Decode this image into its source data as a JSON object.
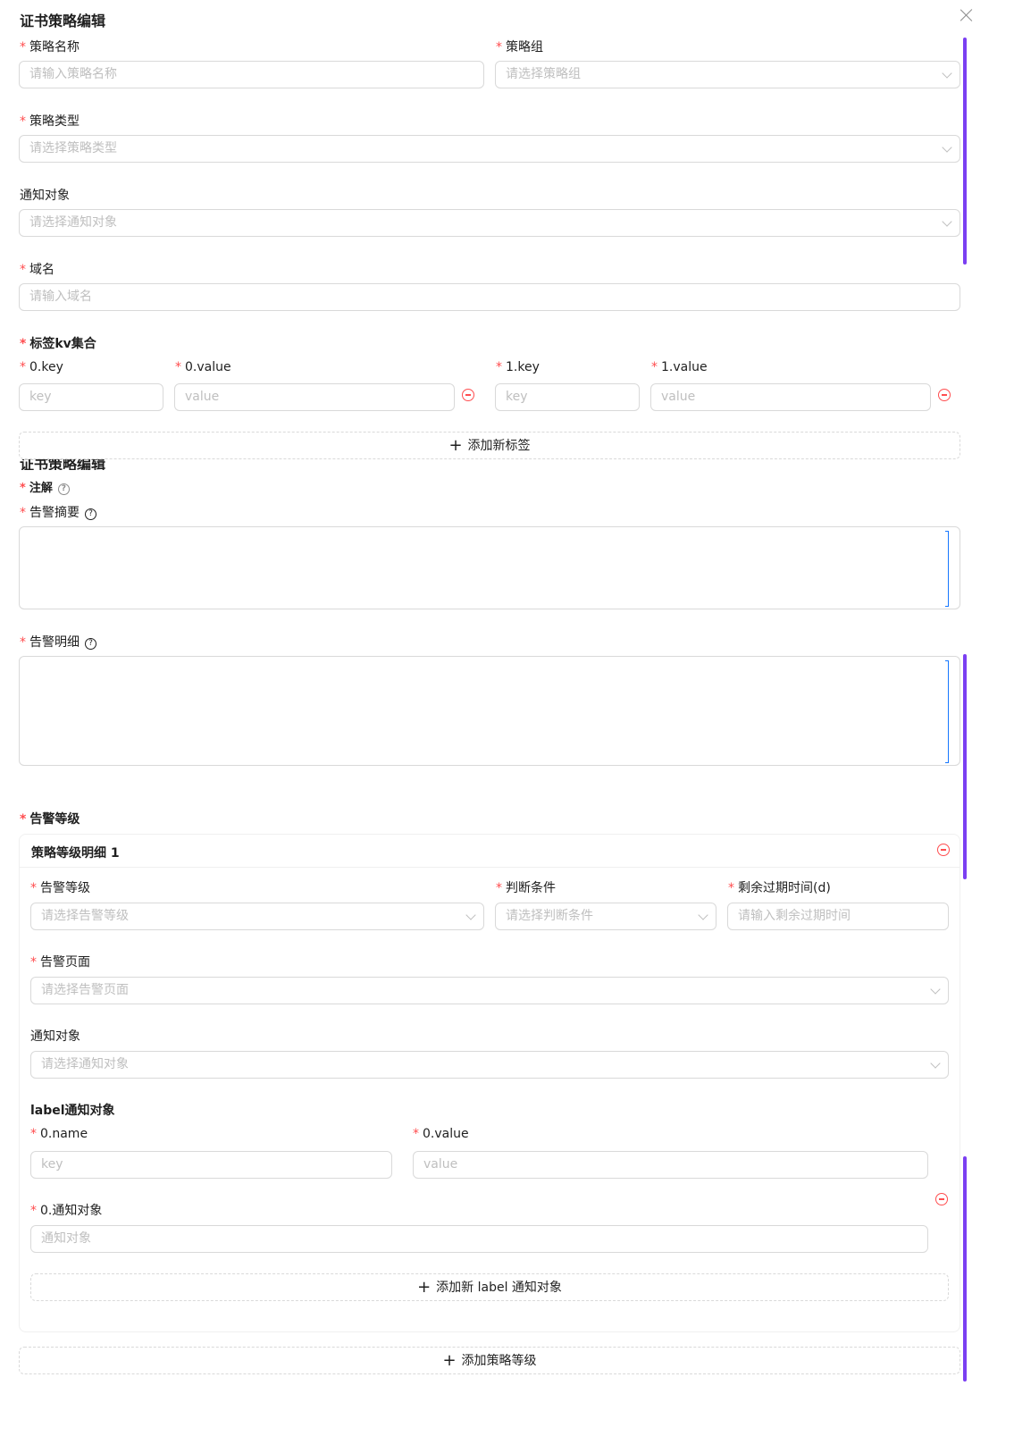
{
  "dialog": {
    "title": "证书策略编辑",
    "ghost_title": "证书策略编辑"
  },
  "fields": {
    "name": {
      "label": "策略名称",
      "placeholder": "请输入策略名称"
    },
    "group": {
      "label": "策略组",
      "placeholder": "请选择策略组"
    },
    "type": {
      "label": "策略类型",
      "placeholder": "请选择策略类型"
    },
    "notify": {
      "label": "通知对象",
      "placeholder": "请选择通知对象"
    },
    "domain": {
      "label": "域名",
      "placeholder": "请输入域名"
    }
  },
  "labels_kv": {
    "title": "标签kv集合",
    "items": [
      {
        "key_label": "0.key",
        "value_label": "0.value",
        "key_placeholder": "key",
        "value_placeholder": "value"
      },
      {
        "key_label": "1.key",
        "value_label": "1.value",
        "key_placeholder": "key",
        "value_placeholder": "value"
      }
    ],
    "add_label": "添加新标签"
  },
  "annotations": {
    "label": "注解",
    "summary": {
      "label": "告警摘要",
      "help": "?"
    },
    "detail": {
      "label": "告警明细",
      "help": "?"
    }
  },
  "alert_levels": {
    "title": "告警等级",
    "card": {
      "title": "策略等级明细 1",
      "level": {
        "label": "告警等级",
        "placeholder": "请选择告警等级"
      },
      "condition": {
        "label": "判断条件",
        "placeholder": "请选择判断条件"
      },
      "remaining": {
        "label": "剩余过期时间(d)",
        "placeholder": "请输入剩余过期时间"
      },
      "page": {
        "label": "告警页面",
        "placeholder": "请选择告警页面"
      },
      "notify": {
        "label": "通知对象",
        "placeholder": "请选择通知对象"
      },
      "label_notify": {
        "title": "label通知对象",
        "name_label": "0.name",
        "name_placeholder": "key",
        "value_label": "0.value",
        "value_placeholder": "value",
        "target_label": "0.通知对象",
        "target_placeholder": "通知对象",
        "add_label": "添加新 label 通知对象"
      }
    },
    "add_label": "添加策略等级"
  },
  "icons": {
    "plus": "+",
    "close": "close-icon",
    "minus": "minus-circle-icon",
    "chevron": "chevron-down-icon"
  },
  "colors": {
    "required": "#ff4d4f",
    "scrollbar": "#7b3ff2",
    "focus": "#1677ff"
  }
}
